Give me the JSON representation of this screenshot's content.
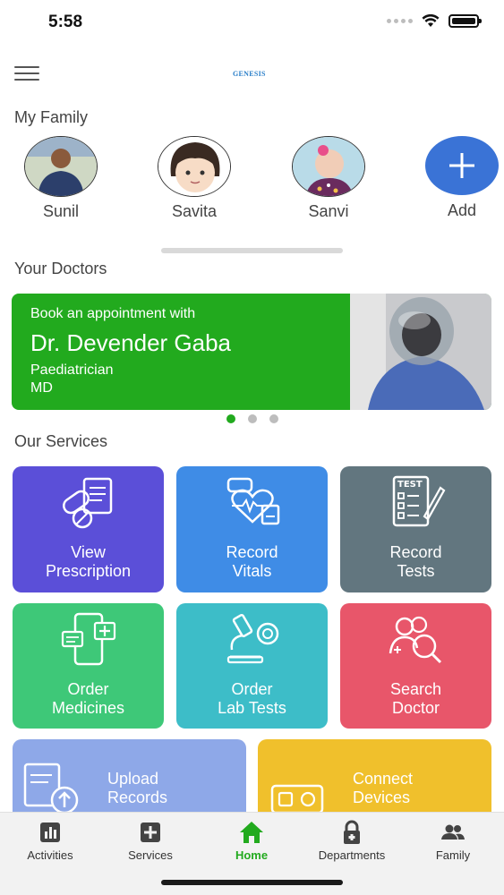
{
  "status_bar": {
    "time": "5:58"
  },
  "header": {
    "logo_text": "GENESIS"
  },
  "family": {
    "title": "My Family",
    "members": [
      {
        "name": "Sunil"
      },
      {
        "name": "Savita"
      },
      {
        "name": "Sanvi"
      }
    ],
    "add_label": "Add"
  },
  "doctors": {
    "title": "Your Doctors",
    "card": {
      "intro": "Book an appointment with",
      "name": "Dr. Devender Gaba",
      "specialty": "Paediatrician",
      "degree": "MD"
    },
    "carousel_pages": 3,
    "carousel_active": 0
  },
  "services": {
    "title": "Our Services",
    "tiles": [
      {
        "line1": "View",
        "line2": "Prescription",
        "color": "#5b4fd8",
        "icon": "prescription-pills-icon"
      },
      {
        "line1": "Record",
        "line2": "Vitals",
        "color": "#3f8ce6",
        "icon": "vitals-heart-icon"
      },
      {
        "line1": "Record",
        "line2": "Tests",
        "color": "#62767f",
        "icon": "test-clipboard-icon"
      },
      {
        "line1": "Order",
        "line2": "Medicines",
        "color": "#3ec878",
        "icon": "phone-medicine-icon"
      },
      {
        "line1": "Order",
        "line2": "Lab Tests",
        "color": "#3dbdc8",
        "icon": "microscope-icon"
      },
      {
        "line1": "Search",
        "line2": "Doctor",
        "color": "#e8566a",
        "icon": "search-doctor-icon"
      },
      {
        "line1": "Upload",
        "line2": "Records",
        "color": "#8ea8e8",
        "icon": "upload-records-icon"
      },
      {
        "line1": "Connect",
        "line2": "Devices",
        "color": "#f0c02c",
        "icon": "connect-devices-icon"
      }
    ]
  },
  "bottom_nav": {
    "items": [
      {
        "label": "Activities",
        "icon": "bar-chart-icon"
      },
      {
        "label": "Services",
        "icon": "plus-square-icon"
      },
      {
        "label": "Home",
        "icon": "home-icon"
      },
      {
        "label": "Departments",
        "icon": "lock-icon"
      },
      {
        "label": "Family",
        "icon": "people-icon"
      }
    ],
    "active_color": "#22aa1e"
  }
}
